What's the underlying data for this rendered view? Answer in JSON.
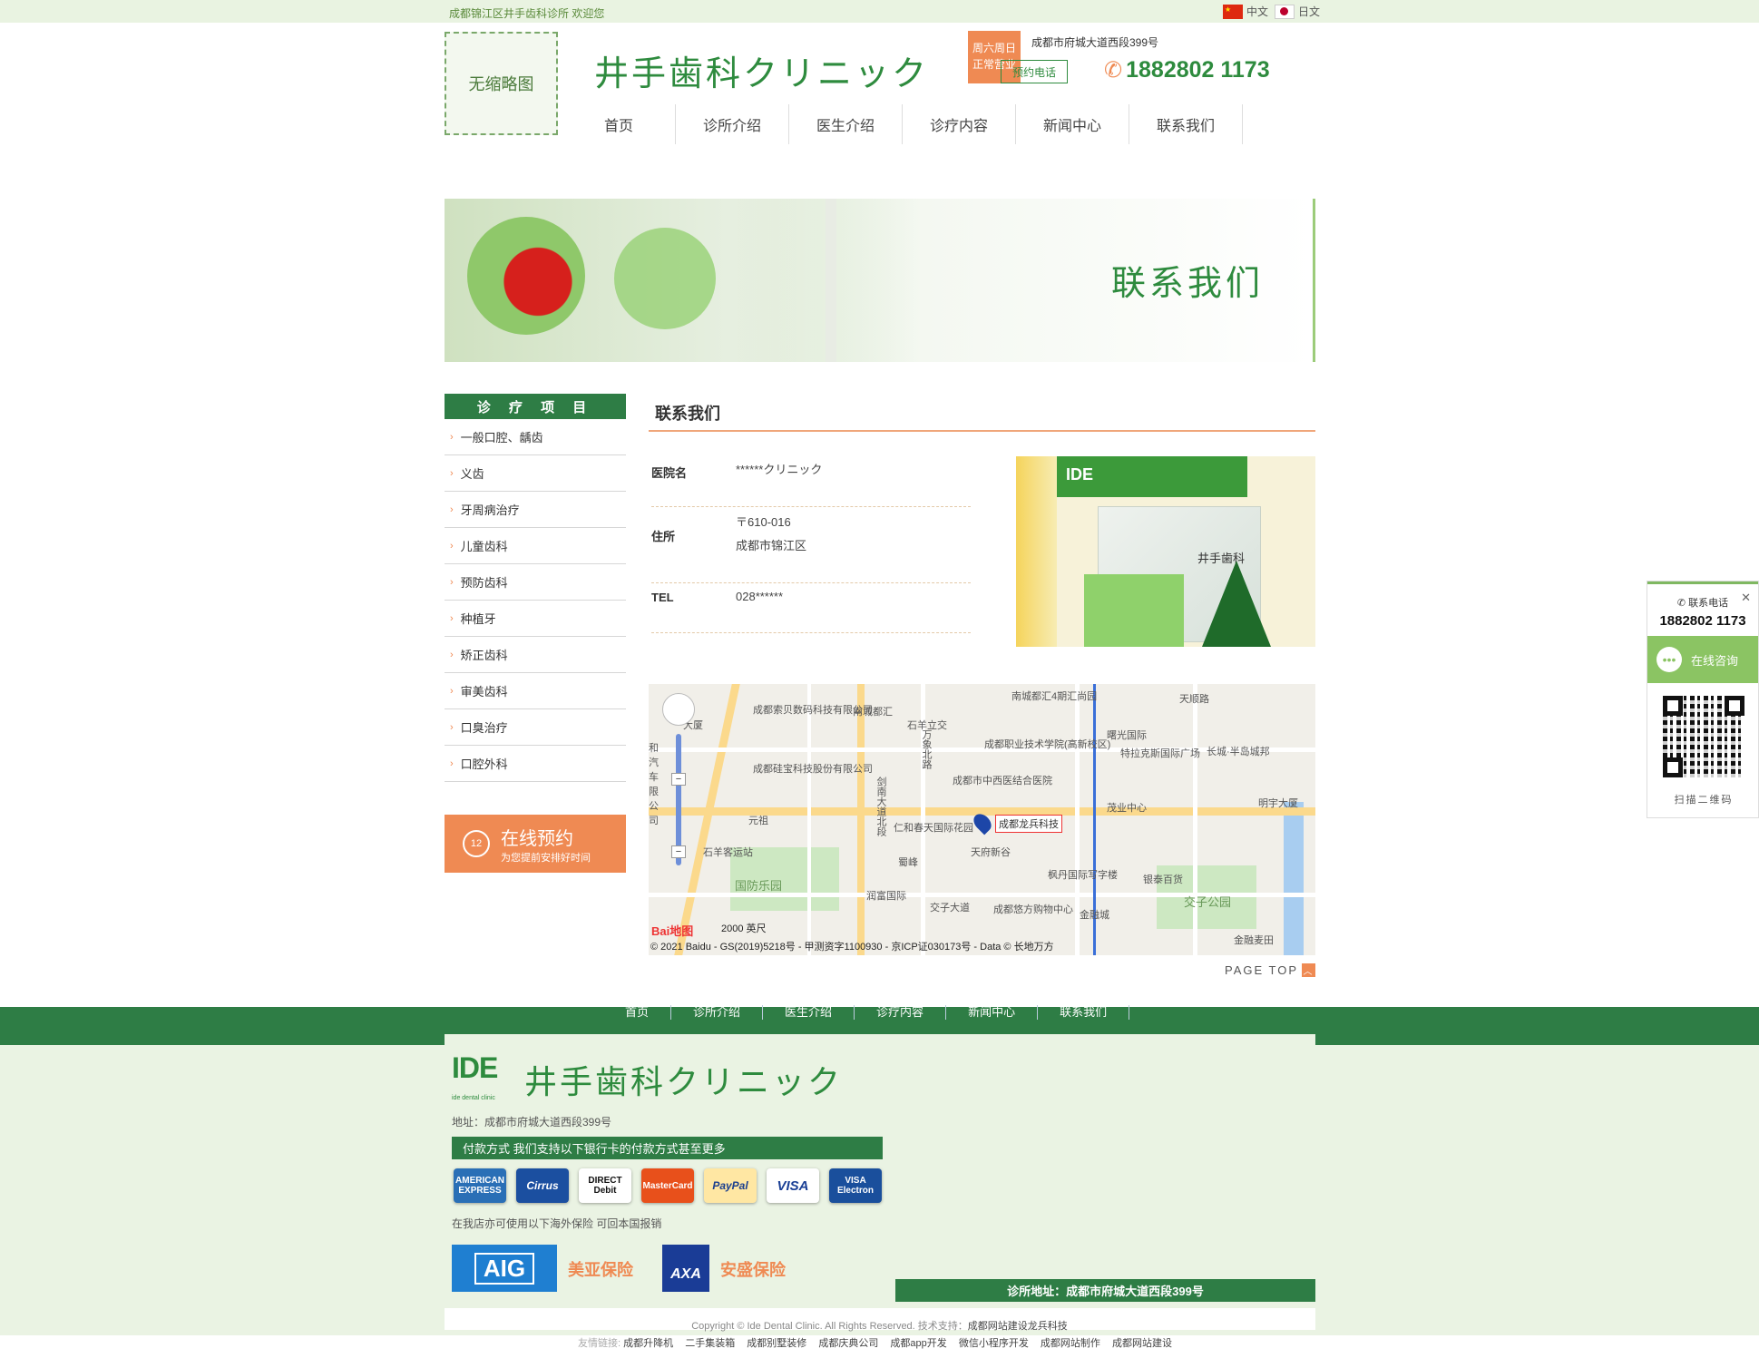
{
  "topbar": {
    "welcome": "成都锦江区井手齿科诊所 欢迎您",
    "lang_cn": "中文",
    "lang_jp": "日文"
  },
  "header": {
    "thumb_text": "无缩略图",
    "brand": "井手歯科クリニック",
    "hours_line1": "周六周日",
    "hours_line2": "正常营业",
    "address": "成都市府城大道西段399号",
    "call_label": "预约电话",
    "phone": "1882802 1173"
  },
  "nav": [
    "首页",
    "诊所介绍",
    "医生介绍",
    "诊疗内容",
    "新闻中心",
    "联系我们"
  ],
  "banner": {
    "title": "联系我们"
  },
  "sidebar": {
    "heading": "诊 疗 项 目",
    "items": [
      "一般口腔、龋齿",
      "义齿",
      "牙周病治疗",
      "儿童齿科",
      "预防齿科",
      "种植牙",
      "矫正齿科",
      "审美齿科",
      "口臭治疗",
      "口腔外科"
    ],
    "booking_title": "在线预约",
    "booking_sub": "为您提前安排好时间",
    "booking_icon": "12"
  },
  "main": {
    "title": "联系我们",
    "rows": [
      {
        "label": "医院名",
        "value": "******クリニック"
      },
      {
        "label": "住所",
        "value": "〒610-016",
        "value2": "成都市锦江区"
      },
      {
        "label": "TEL",
        "value": "028******"
      }
    ],
    "photo_sign": "井手歯科",
    "photo_logo": "IDE"
  },
  "map": {
    "labels": [
      "南城都汇4期汇尚园",
      "成都索贝数码科技有限公司",
      "南城都汇",
      "石羊立交",
      "天顺路",
      "成都职业技术学院(高新校区)",
      "曙光国际",
      "特拉克斯国际广场",
      "长城·半岛城邦",
      "成都硅宝科技股份有限公司",
      "成都市中西医结合医院",
      "明宇大厦",
      "茂业中心",
      "元祖",
      "仁和春天国际花园",
      "天府新谷",
      "石羊客运站",
      "国防乐园",
      "蜀峰",
      "枫丹国际写字楼",
      "银泰百货",
      "交子公园",
      "润富国际",
      "交子大道",
      "成都悠方购物中心",
      "金融城",
      "金融麦田",
      "大厦",
      "剑南大道北段",
      "万象北路",
      "和汽车限公司"
    ],
    "pin_label": "成都龙兵科技",
    "scale": "2000 英尺",
    "copyright": "© 2021 Baidu - GS(2019)5218号 - 甲测资字1100930 - 京ICP证030173号 - Data © 长地万方",
    "logo": "Bai地图"
  },
  "page_top": "PAGE TOP",
  "float_panel": {
    "phone_label": "联系电话",
    "phone": "1882802 1173",
    "chat": "在线咨询",
    "scan": "扫描二维码"
  },
  "footer": {
    "nav": [
      "首页",
      "诊所介绍",
      "医生介绍",
      "诊疗内容",
      "新闻中心",
      "联系我们"
    ],
    "logo": "IDE",
    "logo_sub": "ide dental clinic",
    "brand": "井手歯科クリニック",
    "address": "地址：成都市府城大道西段399号",
    "pay_head": "付款方式 我们支持以下银行卡的付款方式甚至更多",
    "cards": [
      {
        "label": "AMERICAN EXPRESS",
        "color": "#2a6fb6"
      },
      {
        "label": "Cirrus",
        "color": "#1b4fa0"
      },
      {
        "label": "DIRECT Debit",
        "color": "#ffffff"
      },
      {
        "label": "MasterCard",
        "color": "#e8501b"
      },
      {
        "label": "PayPal",
        "color": "#ffe7a3"
      },
      {
        "label": "VISA",
        "color": "#ffffff"
      },
      {
        "label": "VISA Electron",
        "color": "#1a4f9c"
      }
    ],
    "insurance_note": "在我店亦可使用以下海外保险 可回本国报销",
    "aig": "AIG",
    "aig_name": "美亚保险",
    "axa": "AXA",
    "axa_name": "安盛保险",
    "clinic_addr": "诊所地址：成都市府城大道西段399号",
    "copyright": "Copyright © Ide Dental Clinic. All Rights Reserved. 技术支持：",
    "copyright_link": "成都网站建设龙兵科技",
    "links_label": "友情链接:",
    "links": [
      "成都升降机",
      "二手集装箱",
      "成都别墅装修",
      "成都庆典公司",
      "成都app开发",
      "微信小程序开发",
      "成都网站制作",
      "成都网站建设"
    ]
  }
}
